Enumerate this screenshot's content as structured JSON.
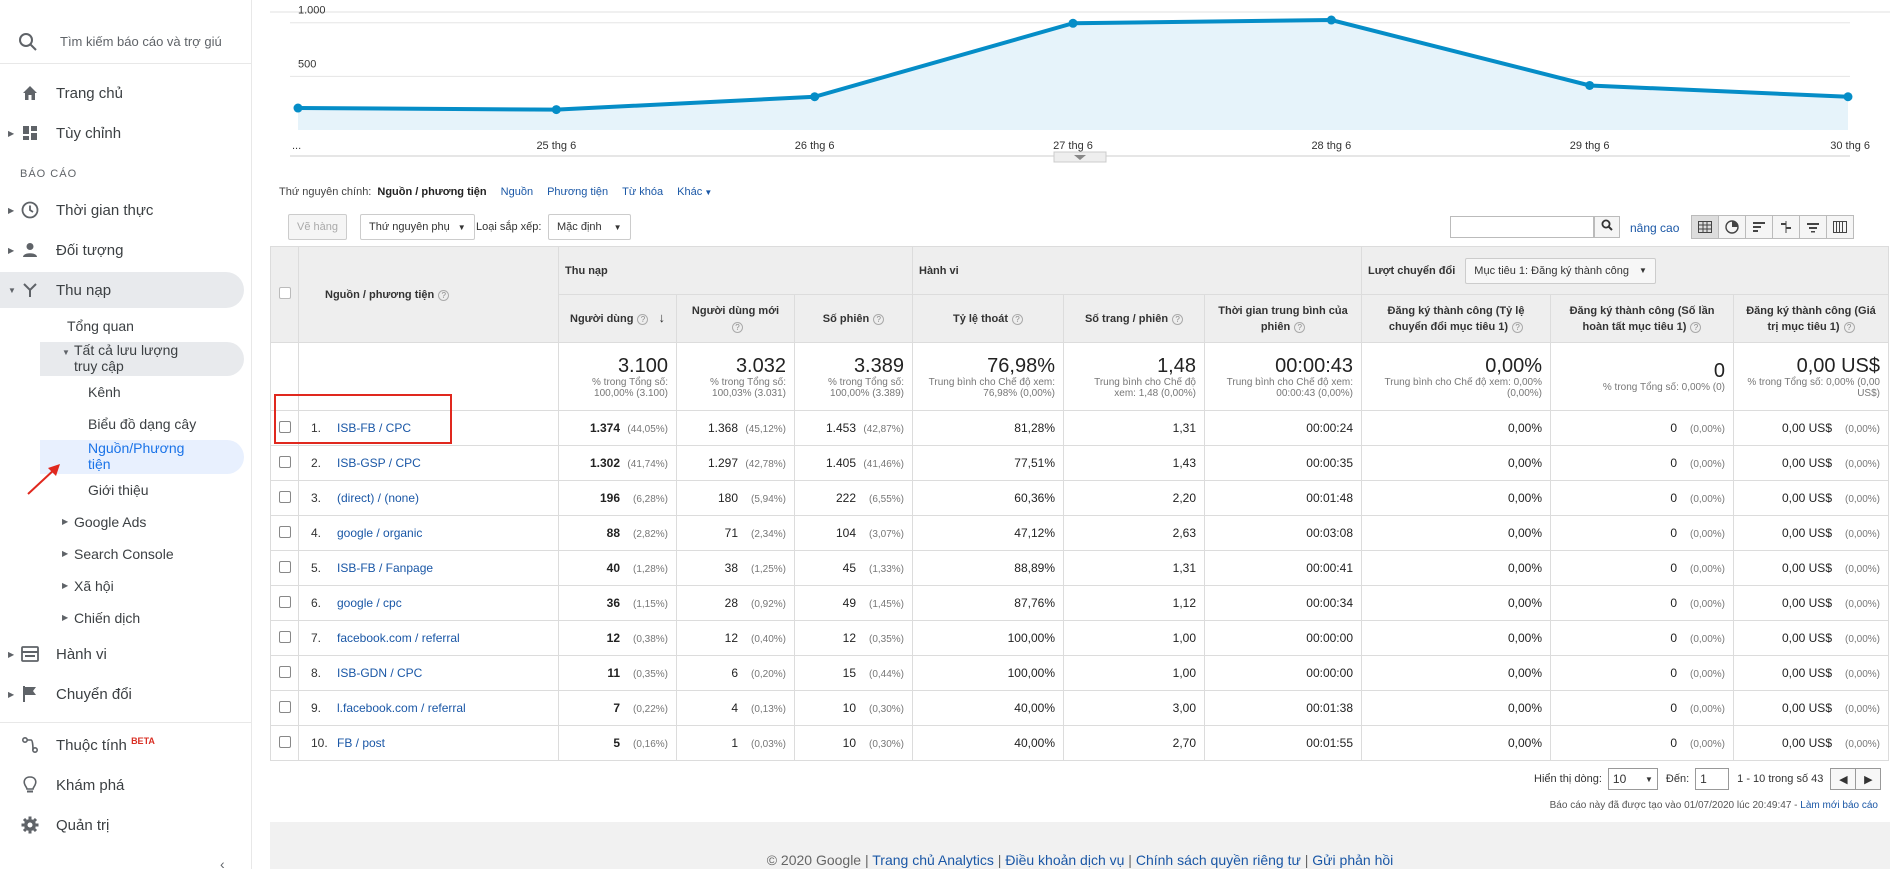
{
  "sidebar": {
    "search_placeholder": "Tìm kiếm báo cáo và trợ giú",
    "home": "Trang chủ",
    "customize": "Tùy chỉnh",
    "section_reports": "BÁO CÁO",
    "realtime": "Thời gian thực",
    "audience": "Đối tượng",
    "acquisition": "Thu nạp",
    "overview": "Tổng quan",
    "all_traffic_1": "Tất cả lưu lượng",
    "all_traffic_2": "truy cập",
    "channels": "Kênh",
    "treemaps": "Biểu đồ dạng cây",
    "source_medium_1": "Nguồn/Phương",
    "source_medium_2": "tiện",
    "referrals": "Giới thiệu",
    "google_ads": "Google Ads",
    "search_console": "Search Console",
    "social": "Xã hội",
    "campaigns": "Chiến dịch",
    "behavior": "Hành vi",
    "conversions": "Chuyển đổi",
    "attribution": "Thuộc tính",
    "beta": "BETA",
    "discover": "Khám phá",
    "admin": "Quản trị"
  },
  "chart_data": {
    "type": "area",
    "x": [
      "...",
      "25 thg 6",
      "26 thg 6",
      "27 thg 6",
      "28 thg 6",
      "29 thg 6",
      "30 thg 6"
    ],
    "values": [
      205,
      190,
      310,
      995,
      1025,
      415,
      310
    ],
    "yticks": [
      "1.000",
      "500"
    ],
    "ylim": [
      0,
      1100
    ],
    "grid": true,
    "color": "#058dc7"
  },
  "dimension": {
    "label": "Thứ nguyên chính:",
    "current": "Nguồn / phương tiện",
    "links": [
      "Nguồn",
      "Phương tiện",
      "Từ khóa",
      "Khác"
    ]
  },
  "toolbar": {
    "plot_rows": "Vẽ hàng",
    "secondary": "Thứ nguyên phụ",
    "sort_label": "Loại sắp xếp:",
    "sort_value": "Mặc định",
    "advanced": "nâng cao"
  },
  "table": {
    "groups": {
      "acquisition": "Thu nạp",
      "behavior": "Hành vi",
      "conversions": "Lượt chuyển đổi",
      "goal_select": "Mục tiêu 1: Đăng ký thành công"
    },
    "dim_header": "Nguồn / phương tiện",
    "columns": [
      "Người dùng",
      "Người dùng mới",
      "Số phiên",
      "Tỷ lệ thoát",
      "Số trang / phiên",
      "Thời gian trung bình của phiên",
      "Đăng ký thành công (Tỷ lệ chuyển đổi mục tiêu 1)",
      "Đăng ký thành công (Số lần hoàn tất mục tiêu 1)",
      "Đăng ký thành công (Giá trị mục tiêu 1)"
    ],
    "totals": [
      {
        "big": "3.100",
        "small": "% trong Tổng số: 100,00% (3.100)"
      },
      {
        "big": "3.032",
        "small": "% trong Tổng số: 100,03% (3.031)"
      },
      {
        "big": "3.389",
        "small": "% trong Tổng số: 100,00% (3.389)"
      },
      {
        "big": "76,98%",
        "small": "Trung bình cho Chế độ xem: 76,98% (0,00%)"
      },
      {
        "big": "1,48",
        "small": "Trung bình cho Chế độ xem: 1,48 (0,00%)"
      },
      {
        "big": "00:00:43",
        "small": "Trung bình cho Chế độ xem: 00:00:43 (0,00%)"
      },
      {
        "big": "0,00%",
        "small": "Trung bình cho Chế độ xem: 0,00% (0,00%)"
      },
      {
        "big": "0",
        "small": "% trong Tổng số: 0,00% (0)"
      },
      {
        "big": "0,00 US$",
        "small": "% trong Tổng số: 0,00% (0,00 US$)"
      }
    ],
    "rows": [
      {
        "idx": "1.",
        "name": "ISB-FB / CPC",
        "users": "1.374",
        "users_pct": "(44,05%)",
        "new": "1.368",
        "new_pct": "(45,12%)",
        "sess": "1.453",
        "sess_pct": "(42,87%)",
        "bounce": "81,28%",
        "pps": "1,31",
        "dur": "00:00:24",
        "cr": "0,00%",
        "comp": "0",
        "comp_pct": "(0,00%)",
        "val": "0,00 US$",
        "val_pct": "(0,00%)"
      },
      {
        "idx": "2.",
        "name": "ISB-GSP / CPC",
        "users": "1.302",
        "users_pct": "(41,74%)",
        "new": "1.297",
        "new_pct": "(42,78%)",
        "sess": "1.405",
        "sess_pct": "(41,46%)",
        "bounce": "77,51%",
        "pps": "1,43",
        "dur": "00:00:35",
        "cr": "0,00%",
        "comp": "0",
        "comp_pct": "(0,00%)",
        "val": "0,00 US$",
        "val_pct": "(0,00%)"
      },
      {
        "idx": "3.",
        "name": "(direct) / (none)",
        "users": "196",
        "users_pct": "(6,28%)",
        "new": "180",
        "new_pct": "(5,94%)",
        "sess": "222",
        "sess_pct": "(6,55%)",
        "bounce": "60,36%",
        "pps": "2,20",
        "dur": "00:01:48",
        "cr": "0,00%",
        "comp": "0",
        "comp_pct": "(0,00%)",
        "val": "0,00 US$",
        "val_pct": "(0,00%)"
      },
      {
        "idx": "4.",
        "name": "google / organic",
        "users": "88",
        "users_pct": "(2,82%)",
        "new": "71",
        "new_pct": "(2,34%)",
        "sess": "104",
        "sess_pct": "(3,07%)",
        "bounce": "47,12%",
        "pps": "2,63",
        "dur": "00:03:08",
        "cr": "0,00%",
        "comp": "0",
        "comp_pct": "(0,00%)",
        "val": "0,00 US$",
        "val_pct": "(0,00%)"
      },
      {
        "idx": "5.",
        "name": "ISB-FB / Fanpage",
        "users": "40",
        "users_pct": "(1,28%)",
        "new": "38",
        "new_pct": "(1,25%)",
        "sess": "45",
        "sess_pct": "(1,33%)",
        "bounce": "88,89%",
        "pps": "1,31",
        "dur": "00:00:41",
        "cr": "0,00%",
        "comp": "0",
        "comp_pct": "(0,00%)",
        "val": "0,00 US$",
        "val_pct": "(0,00%)"
      },
      {
        "idx": "6.",
        "name": "google / cpc",
        "users": "36",
        "users_pct": "(1,15%)",
        "new": "28",
        "new_pct": "(0,92%)",
        "sess": "49",
        "sess_pct": "(1,45%)",
        "bounce": "87,76%",
        "pps": "1,12",
        "dur": "00:00:34",
        "cr": "0,00%",
        "comp": "0",
        "comp_pct": "(0,00%)",
        "val": "0,00 US$",
        "val_pct": "(0,00%)"
      },
      {
        "idx": "7.",
        "name": "facebook.com / referral",
        "users": "12",
        "users_pct": "(0,38%)",
        "new": "12",
        "new_pct": "(0,40%)",
        "sess": "12",
        "sess_pct": "(0,35%)",
        "bounce": "100,00%",
        "pps": "1,00",
        "dur": "00:00:00",
        "cr": "0,00%",
        "comp": "0",
        "comp_pct": "(0,00%)",
        "val": "0,00 US$",
        "val_pct": "(0,00%)"
      },
      {
        "idx": "8.",
        "name": "ISB-GDN / CPC",
        "users": "11",
        "users_pct": "(0,35%)",
        "new": "6",
        "new_pct": "(0,20%)",
        "sess": "15",
        "sess_pct": "(0,44%)",
        "bounce": "100,00%",
        "pps": "1,00",
        "dur": "00:00:00",
        "cr": "0,00%",
        "comp": "0",
        "comp_pct": "(0,00%)",
        "val": "0,00 US$",
        "val_pct": "(0,00%)"
      },
      {
        "idx": "9.",
        "name": "l.facebook.com / referral",
        "users": "7",
        "users_pct": "(0,22%)",
        "new": "4",
        "new_pct": "(0,13%)",
        "sess": "10",
        "sess_pct": "(0,30%)",
        "bounce": "40,00%",
        "pps": "3,00",
        "dur": "00:01:38",
        "cr": "0,00%",
        "comp": "0",
        "comp_pct": "(0,00%)",
        "val": "0,00 US$",
        "val_pct": "(0,00%)"
      },
      {
        "idx": "10.",
        "name": "FB / post",
        "users": "5",
        "users_pct": "(0,16%)",
        "new": "1",
        "new_pct": "(0,03%)",
        "sess": "10",
        "sess_pct": "(0,30%)",
        "bounce": "40,00%",
        "pps": "2,70",
        "dur": "00:01:55",
        "cr": "0,00%",
        "comp": "0",
        "comp_pct": "(0,00%)",
        "val": "0,00 US$",
        "val_pct": "(0,00%)"
      }
    ]
  },
  "pager": {
    "show_rows": "Hiển thị dòng:",
    "rows_value": "10",
    "goto": "Đến:",
    "goto_value": "1",
    "range": "1 - 10 trong số 43"
  },
  "created": {
    "text": "Báo cáo này đã được tạo vào 01/07/2020 lúc 20:49:47 -",
    "link": "Làm mới báo cáo"
  },
  "footer": {
    "copyright": "© 2020 Google |",
    "links": [
      "Trang chủ Analytics",
      "Điều khoản dịch vụ",
      "Chính sách quyền riêng tư",
      "Gửi phản hồi"
    ]
  },
  "colors": {
    "accent": "#1a73e8",
    "link": "#1a57a6",
    "line": "#058dc7",
    "highlight_box": "#e0281e"
  }
}
